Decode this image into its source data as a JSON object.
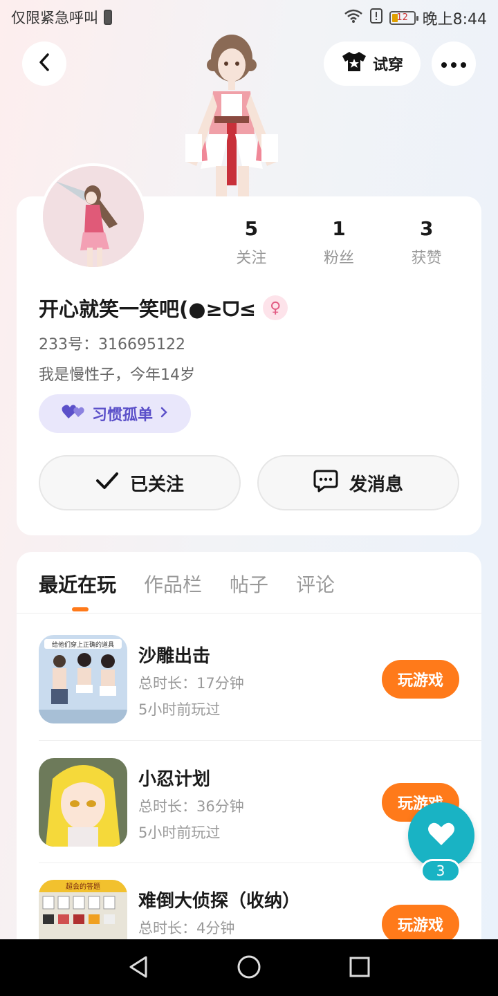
{
  "status_bar": {
    "carrier": "仅限紧急呼叫",
    "battery": "12",
    "time": "晚上8:44"
  },
  "header": {
    "try_on_label": "试穿"
  },
  "profile": {
    "stats": [
      {
        "value": "5",
        "label": "关注"
      },
      {
        "value": "1",
        "label": "粉丝"
      },
      {
        "value": "3",
        "label": "获赞"
      }
    ],
    "username": "开心就笑一笑吧(●≥ᗜ≤",
    "gender_symbol": "♀",
    "uid": "233号：316695122",
    "bio": "我是慢性子，今年14岁",
    "tag": "习惯孤单",
    "follow_label": "已关注",
    "message_label": "发消息"
  },
  "tabs": [
    "最近在玩",
    "作品栏",
    "帖子",
    "评论"
  ],
  "games": [
    {
      "title": "沙雕出击",
      "duration": "总时长：17分钟",
      "last_played": "5小时前玩过",
      "play_label": "玩游戏",
      "banner": "给他们穿上正确的道具"
    },
    {
      "title": "小忍计划",
      "duration": "总时长：36分钟",
      "last_played": "5小时前玩过",
      "play_label": "玩游戏"
    },
    {
      "title": "难倒大侦探（收纳）",
      "duration": "总时长：4分钟",
      "last_played": "",
      "play_label": "玩游戏",
      "banner": "超会的答题"
    }
  ],
  "fab": {
    "count": "3"
  },
  "colors": {
    "accent": "#ff7a1a",
    "fab": "#19b3c4",
    "tag_bg": "#e9e7fb",
    "tag_text": "#5b50c9"
  }
}
